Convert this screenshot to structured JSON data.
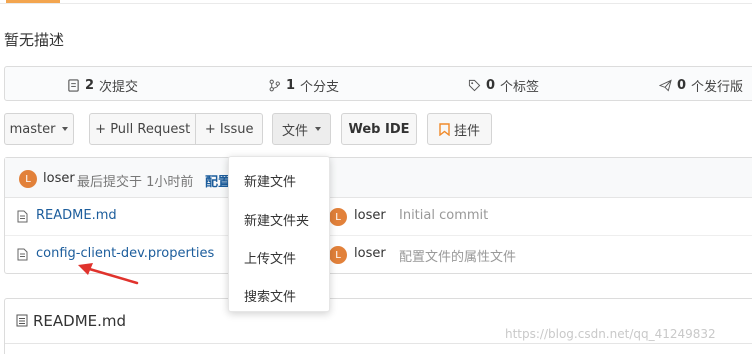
{
  "repo": {
    "description": "暂无描述"
  },
  "stats": {
    "commits_count": "2",
    "commits_label": "次提交",
    "branches_count": "1",
    "branches_label": "个分支",
    "tags_count": "0",
    "tags_label": "个标签",
    "releases_count": "0",
    "releases_label": "个发行版"
  },
  "toolbar": {
    "branch": "master",
    "pull_request": "+ Pull Request",
    "issue": "+ Issue",
    "files": "文件",
    "web_ide": "Web IDE",
    "bookmark": "挂件"
  },
  "commit": {
    "avatar_letter": "L",
    "author": "loser",
    "text": "最后提交于 1小时前",
    "link": "配置"
  },
  "files": [
    {
      "name": "README.md",
      "author": "loser",
      "avatar_letter": "L",
      "message": "Initial commit"
    },
    {
      "name": "config-client-dev.properties",
      "author": "loser",
      "avatar_letter": "L",
      "message": "配置文件的属性文件"
    }
  ],
  "readme": {
    "title": "README.md"
  },
  "dropdown": {
    "items": [
      "新建文件",
      "新建文件夹",
      "上传文件",
      "搜索文件"
    ]
  },
  "watermark": "https://blog.csdn.net/qq_41249832",
  "colors": {
    "accent": "#f3a54f",
    "avatar": "#e2813a",
    "link": "#1c5d9c",
    "arrow": "#e0332d"
  }
}
